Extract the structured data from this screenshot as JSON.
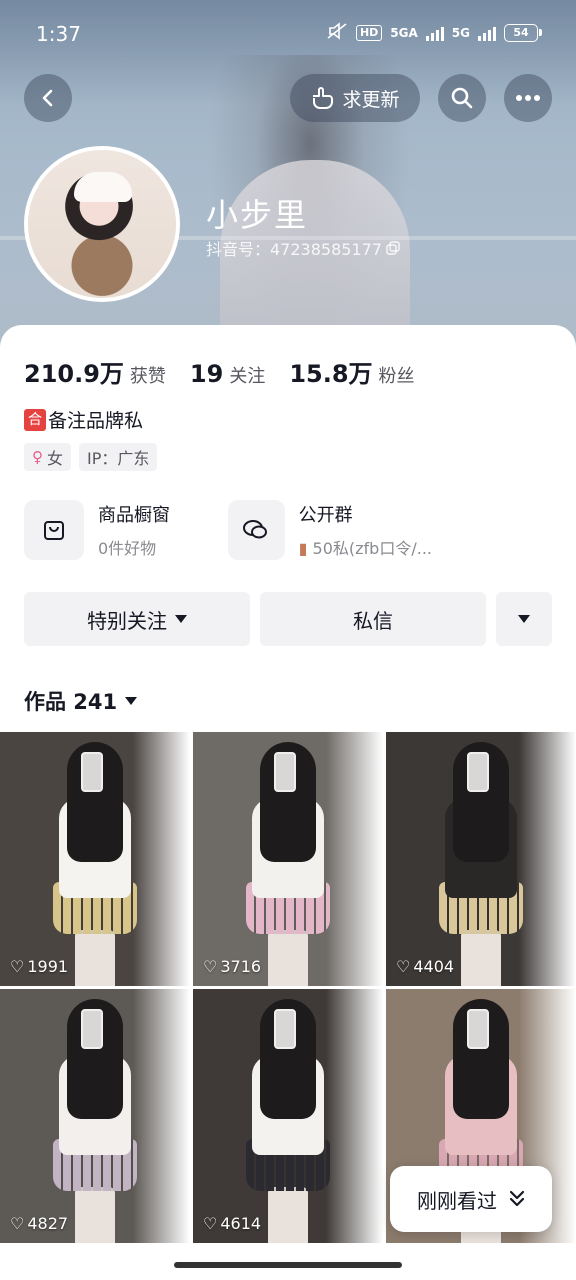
{
  "status_bar": {
    "time": "1:37",
    "network_1": "5GA",
    "network_2": "5G",
    "hd": "HD",
    "battery": "54"
  },
  "header": {
    "update_label": "求更新"
  },
  "profile": {
    "name": "小步里",
    "douyin_id": "抖音号：47238585177",
    "stats": [
      {
        "value": "210.9万",
        "label": "获赞"
      },
      {
        "value": "19",
        "label": "关注"
      },
      {
        "value": "15.8万",
        "label": "粉丝"
      }
    ],
    "bio_badge": "合",
    "bio": "备注品牌私",
    "tags": {
      "gender": "女",
      "ip": "IP：广东"
    }
  },
  "cards": [
    {
      "title": "商品橱窗",
      "subtitle": "0件好物",
      "icon": "bag-icon"
    },
    {
      "title": "公开群",
      "subtitle": "50私(zfb口令/...",
      "icon": "chat-bubbles-icon"
    }
  ],
  "actions": {
    "follow": "特别关注",
    "message": "私信"
  },
  "works": {
    "label": "作品 241"
  },
  "grid": [
    {
      "likes": "1991",
      "bg": "#4b4542",
      "top": "#f5f3ef",
      "skirt": "#d8c58a"
    },
    {
      "likes": "3716",
      "bg": "#6e6a66",
      "top": "#f3f1ee",
      "skirt": "#e3b7c8"
    },
    {
      "likes": "4404",
      "bg": "#3c3836",
      "top": "#2a2727",
      "skirt": "#d9c79a"
    },
    {
      "likes": "4827",
      "bg": "#5d5955",
      "top": "#f2efec",
      "skirt": "#c2b4c3"
    },
    {
      "likes": "4614",
      "bg": "#3f3a37",
      "top": "#f4f2ef",
      "skirt": "#2a2a30"
    },
    {
      "likes": "",
      "bg": "#8c7c6e",
      "top": "#e7bfc2",
      "skirt": "#d9a8b4"
    }
  ],
  "recent_pill": {
    "label": "刚刚看过"
  }
}
